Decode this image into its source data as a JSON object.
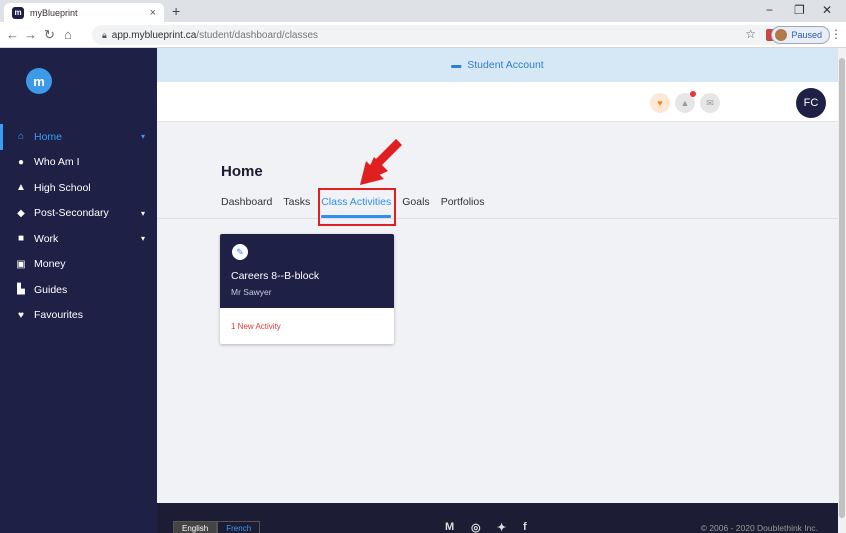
{
  "browser": {
    "tab_title": "myBlueprint",
    "favicon": "m",
    "url_host": "app.myblueprint.ca",
    "url_path": "/student/dashboard/classes",
    "profile_label": "Paused"
  },
  "banner": {
    "label": "Student Account",
    "icon": "bus-icon"
  },
  "sidebar": {
    "logo": "m",
    "items": [
      {
        "label": "Home",
        "icon": "home-icon",
        "glyph": "⌂",
        "chevron": true
      },
      {
        "label": "Who Am I",
        "icon": "compass-icon",
        "glyph": "●",
        "chevron": false
      },
      {
        "label": "High School",
        "icon": "school-icon",
        "glyph": "▲",
        "chevron": false
      },
      {
        "label": "Post-Secondary",
        "icon": "graduation-cap-icon",
        "glyph": "◆",
        "chevron": true
      },
      {
        "label": "Work",
        "icon": "briefcase-icon",
        "glyph": "■",
        "chevron": true
      },
      {
        "label": "Money",
        "icon": "money-icon",
        "glyph": "▣",
        "chevron": false
      },
      {
        "label": "Guides",
        "icon": "book-icon",
        "glyph": "▙",
        "chevron": false
      },
      {
        "label": "Favourites",
        "icon": "heart-icon",
        "glyph": "♥",
        "chevron": false
      }
    ]
  },
  "header": {
    "avatar_initials": "FC"
  },
  "page": {
    "title": "Home",
    "tabs": [
      "Dashboard",
      "Tasks",
      "Class Activities",
      "Goals",
      "Portfolios"
    ],
    "active_tab": "Class Activities"
  },
  "card": {
    "name": "Careers 8--B-block",
    "teacher": "Mr Sawyer",
    "activity": "1 New Activity"
  },
  "footer": {
    "lang_english": "English",
    "lang_french": "French",
    "copyright": "© 2006 - 2020 Doublethink Inc."
  },
  "colors": {
    "sidebar_bg": "#1e2046",
    "accent": "#2f8ff0",
    "alert": "#e53935",
    "banner_bg": "#d6e7f6"
  }
}
